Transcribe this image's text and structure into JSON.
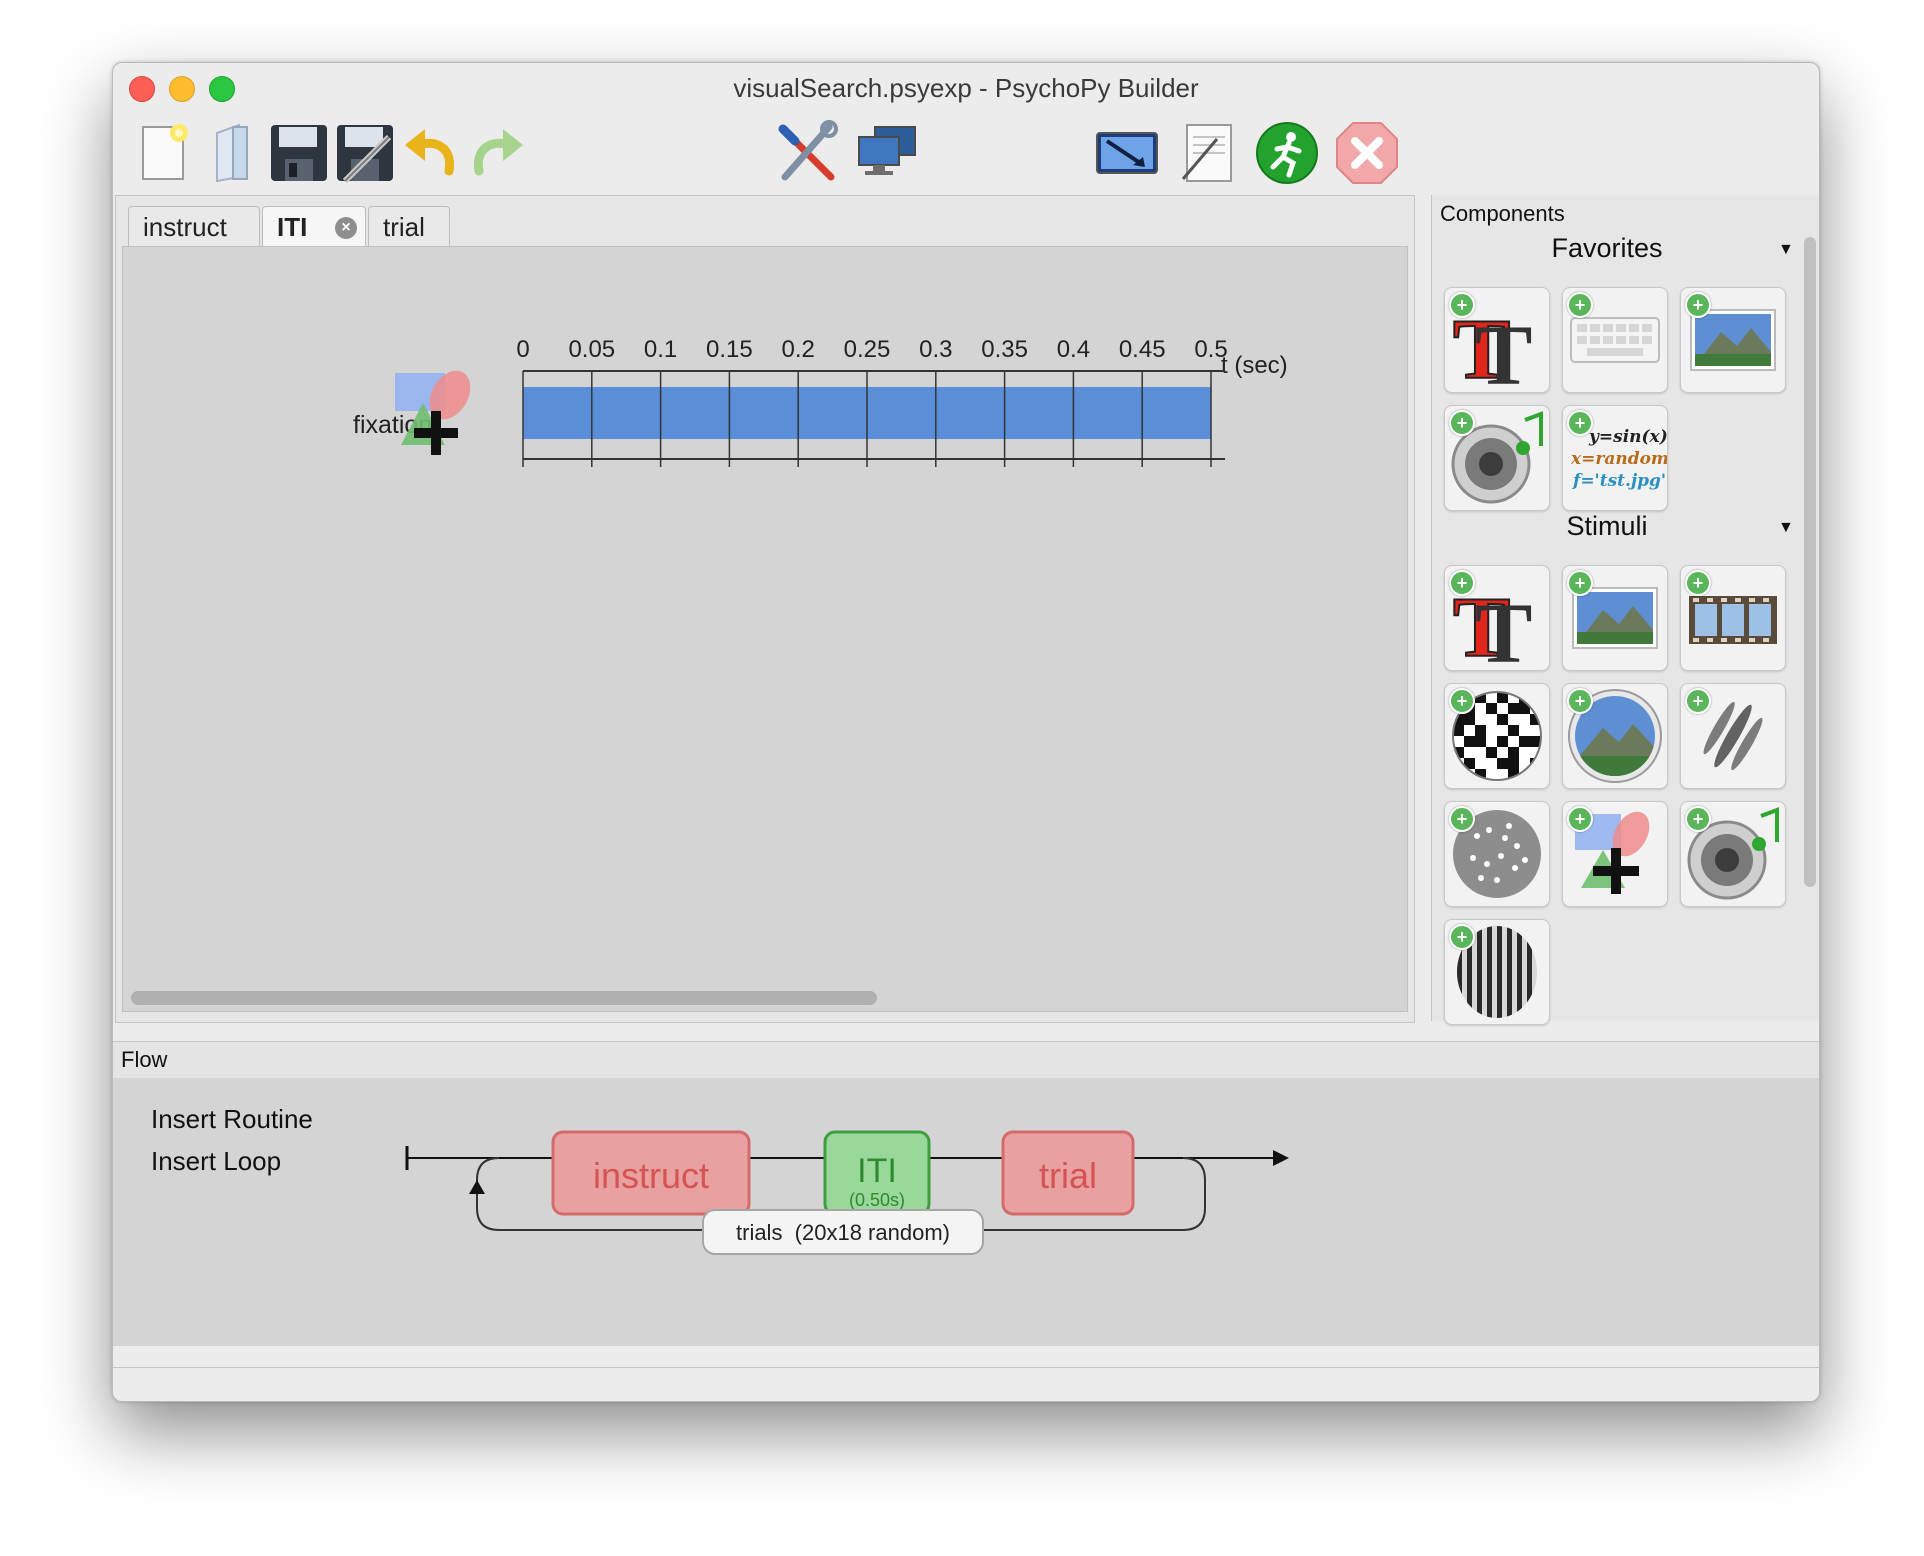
{
  "window": {
    "title": "visualSearch.psyexp - PsychoPy Builder"
  },
  "toolbar": {
    "buttons": [
      {
        "name": "new",
        "icon": "new-file-icon"
      },
      {
        "name": "open",
        "icon": "open-folder-icon"
      },
      {
        "name": "save",
        "icon": "save-icon"
      },
      {
        "name": "save-as",
        "icon": "save-as-icon"
      },
      {
        "name": "undo",
        "icon": "undo-icon"
      },
      {
        "name": "redo",
        "icon": "redo-icon"
      },
      {
        "name": "preferences",
        "icon": "tools-icon"
      },
      {
        "name": "monitor-center",
        "icon": "monitors-icon"
      },
      {
        "name": "experiment-settings",
        "icon": "settings-screen-icon"
      },
      {
        "name": "compile-script",
        "icon": "script-icon"
      },
      {
        "name": "run",
        "icon": "run-icon"
      },
      {
        "name": "stop",
        "icon": "stop-icon"
      }
    ]
  },
  "routine_tabs": [
    {
      "label": "instruct",
      "active": false
    },
    {
      "label": "ITI",
      "active": true
    },
    {
      "label": "trial",
      "active": false
    }
  ],
  "timeline": {
    "component_name": "fixation",
    "ticks": [
      "0",
      "0.05",
      "0.1",
      "0.15",
      "0.2",
      "0.25",
      "0.3",
      "0.35",
      "0.4",
      "0.45",
      "0.5"
    ],
    "axis_label": "t (sec)",
    "bar_start": 0,
    "bar_end": 0.5,
    "bar_color": "#5b8ed8"
  },
  "components": {
    "header": "Components",
    "sections": [
      {
        "title": "Favorites",
        "items": [
          {
            "name": "text",
            "icon": "text-component-icon"
          },
          {
            "name": "keyboard",
            "icon": "keyboard-component-icon"
          },
          {
            "name": "image",
            "icon": "image-component-icon"
          },
          {
            "name": "sound",
            "icon": "sound-component-icon"
          },
          {
            "name": "code",
            "icon": "code-component-icon",
            "lines": [
              "y=sin(x)",
              "x=random(",
              "f='tst.jpg'"
            ]
          }
        ]
      },
      {
        "title": "Stimuli",
        "items": [
          {
            "name": "text",
            "icon": "text-component-icon"
          },
          {
            "name": "image",
            "icon": "image-component-icon"
          },
          {
            "name": "movie",
            "icon": "movie-component-icon"
          },
          {
            "name": "noise",
            "icon": "noise-component-icon"
          },
          {
            "name": "aperture",
            "icon": "aperture-component-icon"
          },
          {
            "name": "grating",
            "icon": "grating-component-icon"
          },
          {
            "name": "dots",
            "icon": "dots-component-icon"
          },
          {
            "name": "polygon",
            "icon": "polygon-component-icon"
          },
          {
            "name": "sound",
            "icon": "sound-component-icon"
          },
          {
            "name": "envelope-grating",
            "icon": "envgrating-component-icon"
          }
        ]
      }
    ]
  },
  "flow": {
    "header": "Flow",
    "insert_routine": "Insert Routine",
    "insert_loop": "Insert Loop",
    "routines": [
      {
        "label": "instruct",
        "duration": "",
        "color": "#e8a0a0"
      },
      {
        "label": "ITI",
        "duration": "(0.50s)",
        "color": "#9ad79a"
      },
      {
        "label": "trial",
        "duration": "",
        "color": "#e8a0a0"
      }
    ],
    "loop_label": "trials  (20x18 random)"
  }
}
